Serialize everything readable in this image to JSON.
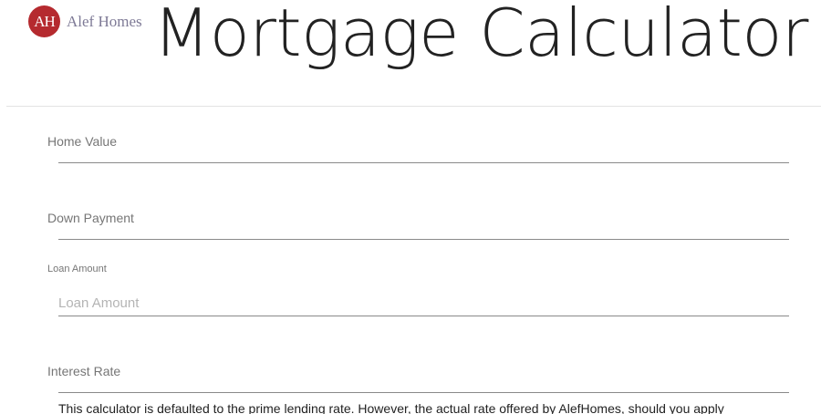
{
  "brand": {
    "logo_initials": "AH",
    "logo_name": "Alef Homes",
    "accent_color": "#b52a2f"
  },
  "header": {
    "title": "Mortgage Calculator"
  },
  "form": {
    "home_value": {
      "label": "Home Value",
      "value": ""
    },
    "down_payment": {
      "label": "Down Payment",
      "value": ""
    },
    "loan_amount": {
      "label": "Loan Amount",
      "placeholder": "Loan Amount",
      "value": ""
    },
    "interest_rate": {
      "label": "Interest Rate",
      "value": ""
    },
    "note": "This calculator is defaulted to the prime lending rate. However, the actual rate offered by AlefHomes, should you apply"
  }
}
